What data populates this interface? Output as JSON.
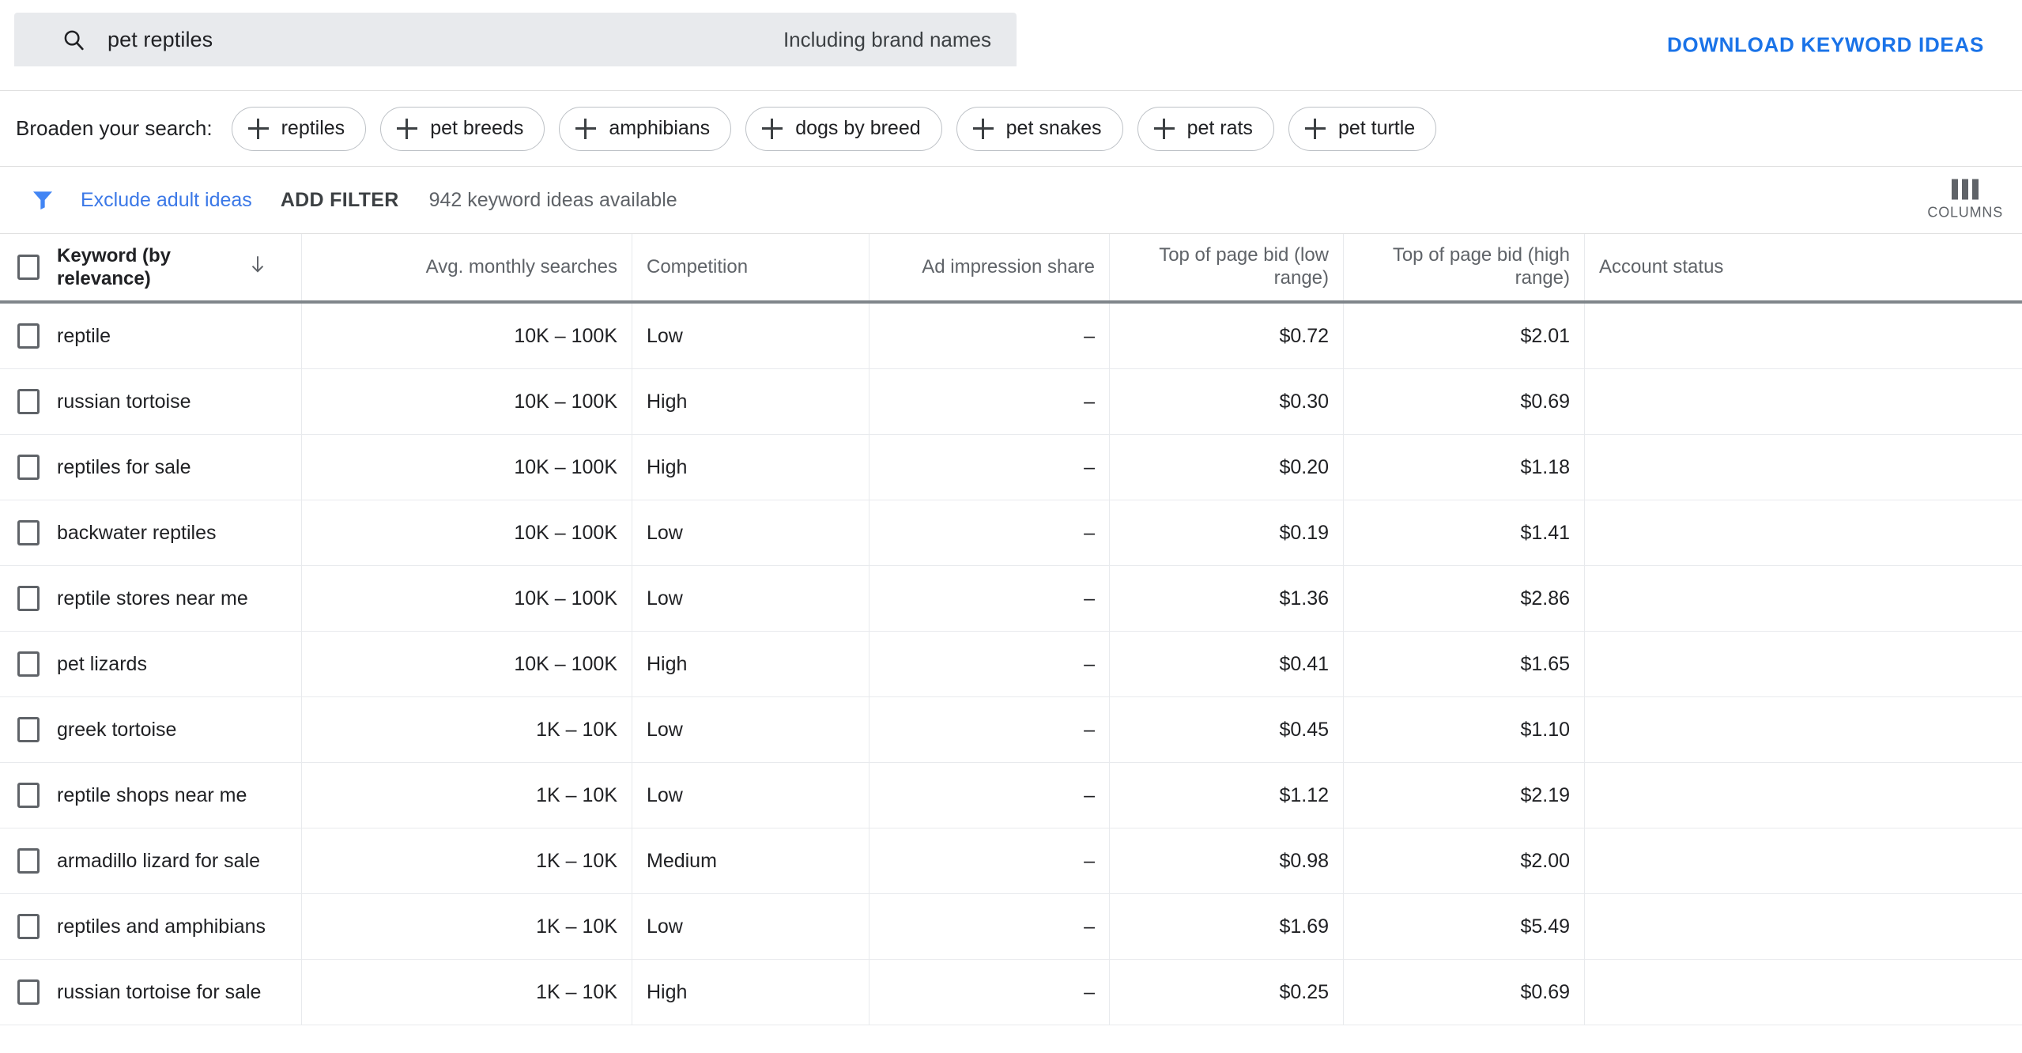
{
  "search": {
    "icon": "search-icon",
    "value": "pet reptiles",
    "brand_toggle_label": "Including brand names",
    "download_label": "DOWNLOAD KEYWORD IDEAS"
  },
  "broaden": {
    "label": "Broaden your search:",
    "chips": [
      {
        "label": "reptiles"
      },
      {
        "label": "pet breeds"
      },
      {
        "label": "amphibians"
      },
      {
        "label": "dogs by breed"
      },
      {
        "label": "pet snakes"
      },
      {
        "label": "pet rats"
      },
      {
        "label": "pet turtle"
      }
    ]
  },
  "filters": {
    "funnel_icon": "filter-funnel-icon",
    "exclude_adult_label": "Exclude adult ideas",
    "add_filter_label": "ADD FILTER",
    "ideas_available": "942 keyword ideas available",
    "columns_label": "COLUMNS",
    "columns_icon": "columns-icon"
  },
  "table": {
    "sort_indicator": "arrow-down-icon",
    "headers": {
      "keyword": "Keyword (by relevance)",
      "searches": "Avg. monthly searches",
      "competition": "Competition",
      "ad_share": "Ad impression share",
      "bid_low": "Top of page bid (low range)",
      "bid_high": "Top of page bid (high range)",
      "account_status": "Account status"
    },
    "rows": [
      {
        "keyword": "reptile",
        "searches": "10K – 100K",
        "competition": "Low",
        "ad_share": "–",
        "bid_low": "$0.72",
        "bid_high": "$2.01",
        "account_status": ""
      },
      {
        "keyword": "russian tortoise",
        "searches": "10K – 100K",
        "competition": "High",
        "ad_share": "–",
        "bid_low": "$0.30",
        "bid_high": "$0.69",
        "account_status": ""
      },
      {
        "keyword": "reptiles for sale",
        "searches": "10K – 100K",
        "competition": "High",
        "ad_share": "–",
        "bid_low": "$0.20",
        "bid_high": "$1.18",
        "account_status": ""
      },
      {
        "keyword": "backwater reptiles",
        "searches": "10K – 100K",
        "competition": "Low",
        "ad_share": "–",
        "bid_low": "$0.19",
        "bid_high": "$1.41",
        "account_status": ""
      },
      {
        "keyword": "reptile stores near me",
        "searches": "10K – 100K",
        "competition": "Low",
        "ad_share": "–",
        "bid_low": "$1.36",
        "bid_high": "$2.86",
        "account_status": ""
      },
      {
        "keyword": "pet lizards",
        "searches": "10K – 100K",
        "competition": "High",
        "ad_share": "–",
        "bid_low": "$0.41",
        "bid_high": "$1.65",
        "account_status": ""
      },
      {
        "keyword": "greek tortoise",
        "searches": "1K – 10K",
        "competition": "Low",
        "ad_share": "–",
        "bid_low": "$0.45",
        "bid_high": "$1.10",
        "account_status": ""
      },
      {
        "keyword": "reptile shops near me",
        "searches": "1K – 10K",
        "competition": "Low",
        "ad_share": "–",
        "bid_low": "$1.12",
        "bid_high": "$2.19",
        "account_status": ""
      },
      {
        "keyword": "armadillo lizard for sale",
        "searches": "1K – 10K",
        "competition": "Medium",
        "ad_share": "–",
        "bid_low": "$0.98",
        "bid_high": "$2.00",
        "account_status": ""
      },
      {
        "keyword": "reptiles and amphibians",
        "searches": "1K – 10K",
        "competition": "Low",
        "ad_share": "–",
        "bid_low": "$1.69",
        "bid_high": "$5.49",
        "account_status": ""
      },
      {
        "keyword": "russian tortoise for sale",
        "searches": "1K – 10K",
        "competition": "High",
        "ad_share": "–",
        "bid_low": "$0.25",
        "bid_high": "$0.69",
        "account_status": ""
      }
    ]
  },
  "colors": {
    "accent_blue": "#1a73e8",
    "link_blue": "#3b78e7",
    "text_primary": "#202124",
    "text_secondary": "#5f6368",
    "search_bg": "#e8eaed",
    "divider": "#e8eaed",
    "header_rule": "#80868b"
  }
}
